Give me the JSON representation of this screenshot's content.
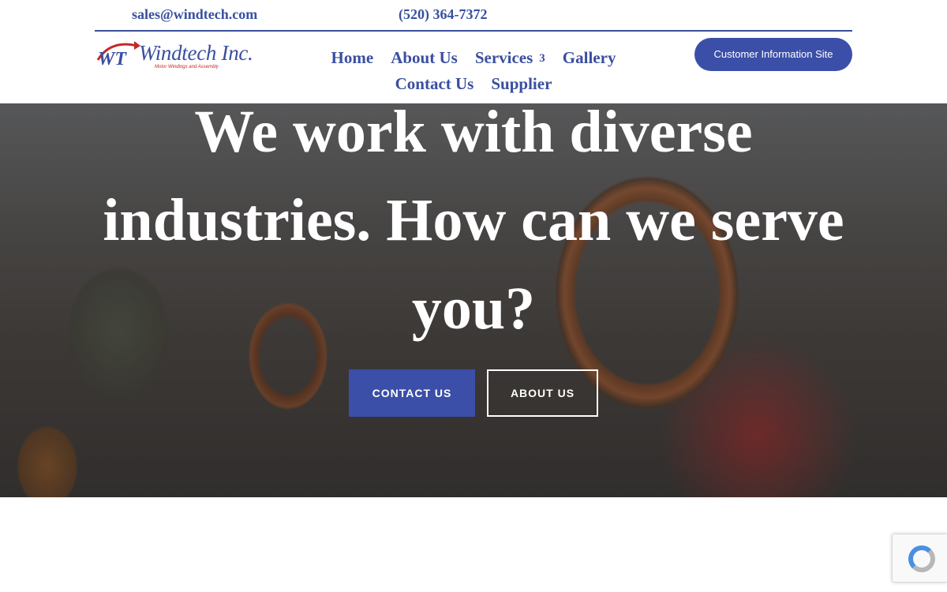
{
  "topbar": {
    "email": "sales@windtech.com",
    "phone": "(520) 364-7372"
  },
  "logo": {
    "name": "Windtech Inc.",
    "tagline": "Motor Windings and Assembly",
    "monogram": "WT"
  },
  "nav": {
    "items": [
      {
        "label": "Home"
      },
      {
        "label": "About Us"
      },
      {
        "label": "Services",
        "caret": "3"
      },
      {
        "label": "Gallery"
      },
      {
        "label": "Contact Us"
      },
      {
        "label": "Supplier"
      }
    ]
  },
  "header_cta": {
    "label": "Customer Information Site"
  },
  "hero": {
    "title": "We work with diverse industries. How can we serve you?",
    "primary_button": "CONTACT US",
    "secondary_button": "ABOUT US"
  },
  "colors": {
    "brand_blue": "#3b4fa8",
    "logo_red": "#c62828"
  },
  "icons": {
    "recaptcha": "recaptcha-icon"
  }
}
